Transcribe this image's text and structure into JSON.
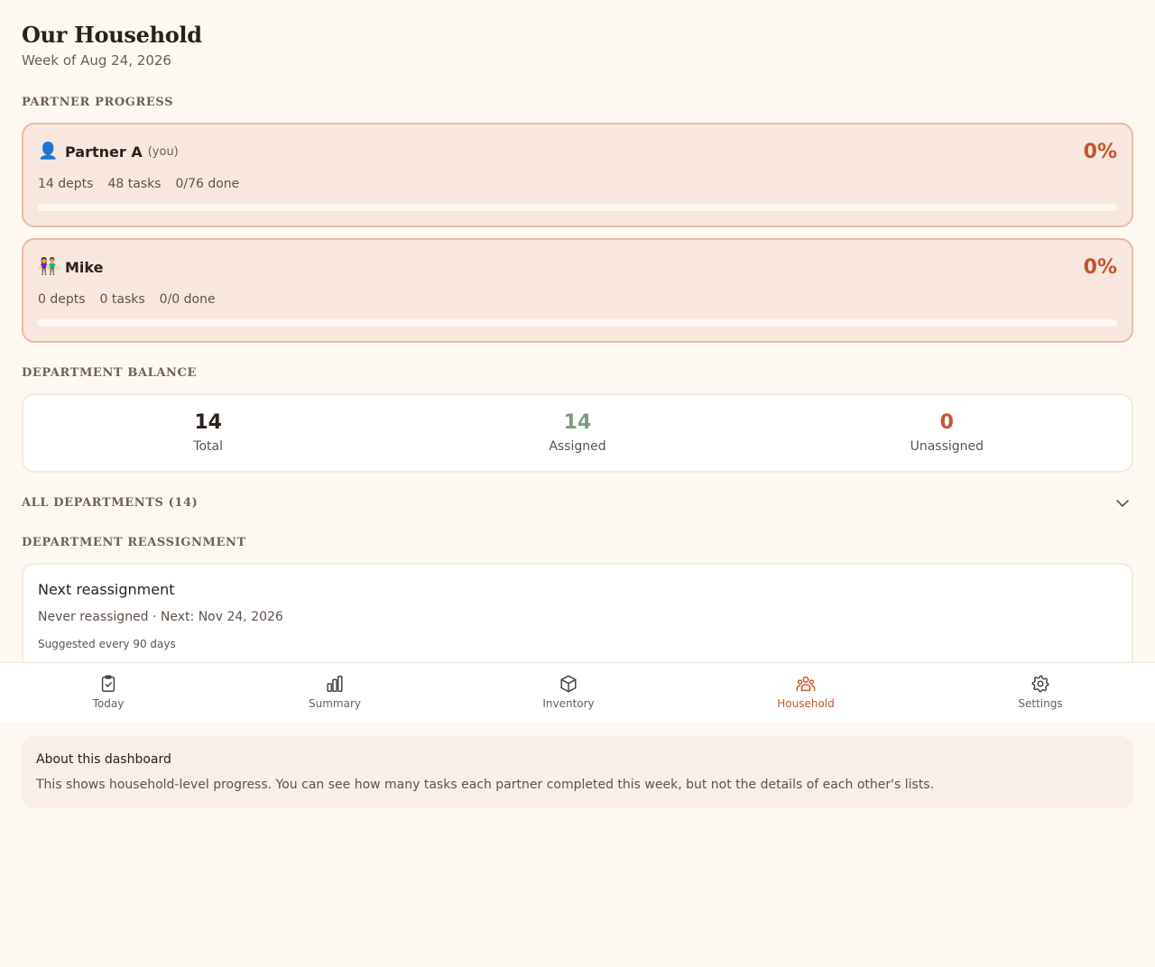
{
  "header": {
    "title": "Our Household",
    "subtitle": "Week of Aug 24, 2026"
  },
  "sections": {
    "partner_progress": "PARTNER PROGRESS",
    "department_balance": "DEPARTMENT BALANCE",
    "all_departments": "ALL DEPARTMENTS (14)",
    "department_reassignment": "DEPARTMENT REASSIGNMENT"
  },
  "partners": [
    {
      "icon": "👤",
      "icon_name": "person-icon",
      "name": "Partner A",
      "you_tag": "(you)",
      "percent": "0%",
      "progress": 0,
      "depts": "14 depts",
      "tasks": "48 tasks",
      "done": "0/76 done"
    },
    {
      "icon": "👫",
      "icon_name": "couple-icon",
      "name": "Mike",
      "you_tag": "",
      "percent": "0%",
      "progress": 0,
      "depts": "0 depts",
      "tasks": "0 tasks",
      "done": "0/0 done"
    }
  ],
  "balance": {
    "total": {
      "value": "14",
      "label": "Total",
      "color": "#2a211c"
    },
    "assigned": {
      "value": "14",
      "label": "Assigned",
      "color": "#7f9b82"
    },
    "unassigned": {
      "value": "0",
      "label": "Unassigned",
      "color": "#c4552f"
    }
  },
  "reassignment": {
    "title": "Next reassignment",
    "meta": "Never reassigned · Next: Nov 24, 2026",
    "note": "Suggested every 90 days"
  },
  "nav": {
    "items": [
      {
        "label": "Today",
        "icon": "clipboard-check-icon",
        "active": false
      },
      {
        "label": "Summary",
        "icon": "bar-chart-icon",
        "active": false
      },
      {
        "label": "Inventory",
        "icon": "box-icon",
        "active": false
      },
      {
        "label": "Household",
        "icon": "users-icon",
        "active": true
      },
      {
        "label": "Settings",
        "icon": "gear-icon",
        "active": false
      }
    ]
  },
  "about": {
    "title": "About this dashboard",
    "text": "This shows household-level progress. You can see how many tasks each partner completed this week, but not the details of each other's lists."
  },
  "colors": {
    "accent": "#c4552f",
    "assigned": "#7f9b82",
    "background": "#fdf9f2",
    "nav_inactive": "#6b5e55"
  }
}
